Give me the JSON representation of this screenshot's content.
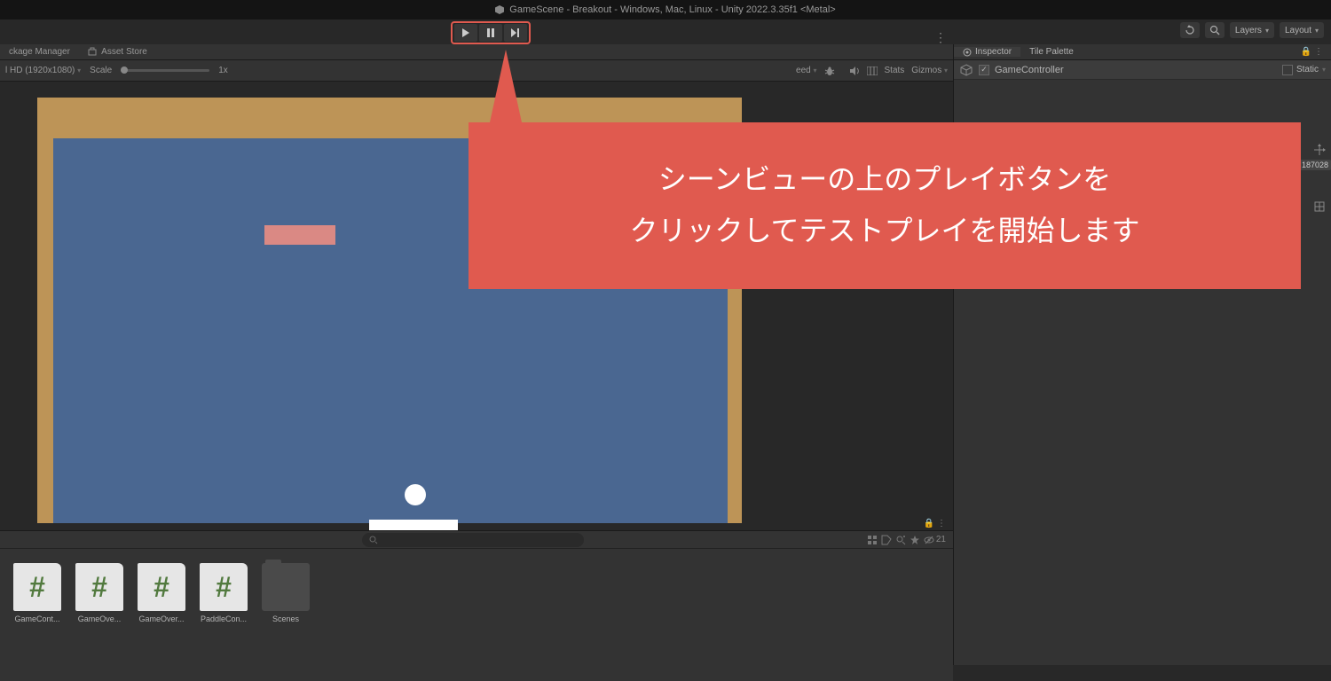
{
  "titlebar": {
    "title": "GameScene - Breakout - Windows, Mac, Linux - Unity 2022.3.35f1 <Metal>"
  },
  "top_tabs": {
    "package_manager": "ckage Manager",
    "asset_store": "Asset Store"
  },
  "game_toolbar": {
    "resolution": "l HD (1920x1080)",
    "scale_label": "Scale",
    "scale_value": "1x",
    "speed_partial": "eed",
    "stats": "Stats",
    "gizmos": "Gizmos"
  },
  "right_dropdowns": {
    "layers": "Layers",
    "layout": "Layout"
  },
  "inspector": {
    "tab_inspector": "Inspector",
    "tab_tile_palette": "Tile Palette",
    "object_name": "GameController",
    "static_label": "Static",
    "badge_text": "187028"
  },
  "project": {
    "hidden_count": "21",
    "assets": [
      {
        "name": "GameCont..."
      },
      {
        "name": "GameOve..."
      },
      {
        "name": "GameOver..."
      },
      {
        "name": "PaddleCon..."
      }
    ],
    "folder": {
      "name": "Scenes"
    }
  },
  "callout": {
    "line1": "シーンビューの上のプレイボタンを",
    "line2": "クリックしてテストプレイを開始します"
  }
}
